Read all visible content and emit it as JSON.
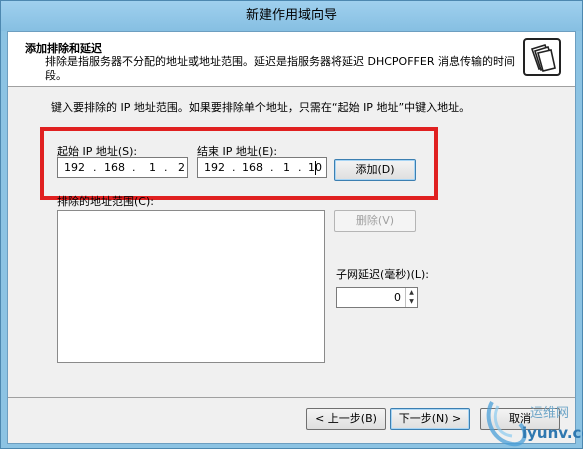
{
  "window": {
    "title": "新建作用域向导"
  },
  "header": {
    "title": "添加排除和延迟",
    "description": "排除是指服务器不分配的地址或地址范围。延迟是指服务器将延迟 DHCPOFFER 消息传输的时间段。",
    "icon": "folders-icon"
  },
  "instruction": "键入要排除的 IP 地址范围。如果要排除单个地址，只需在“起始 IP 地址”中键入地址。",
  "start_ip": {
    "label": "起始 IP 地址(S):",
    "octets": [
      "192",
      "168",
      "1",
      "2"
    ]
  },
  "end_ip": {
    "label": "结束 IP 地址(E):",
    "octets": [
      "192",
      "168",
      "1",
      "10"
    ]
  },
  "add_button": "添加(D)",
  "excluded_range": {
    "label": "排除的地址范围(C):",
    "items": []
  },
  "remove_button": "删除(V)",
  "subnet_delay": {
    "label": "子网延迟(毫秒)(L):",
    "value": "0"
  },
  "footer": {
    "back": "< 上一步(B)",
    "next": "下一步(N) >",
    "cancel": "取消"
  },
  "watermark": {
    "line1": "运维网",
    "line2": "iyunv.com"
  },
  "colors": {
    "highlight": "#e02020",
    "titlebar": "#8cc3e3"
  }
}
